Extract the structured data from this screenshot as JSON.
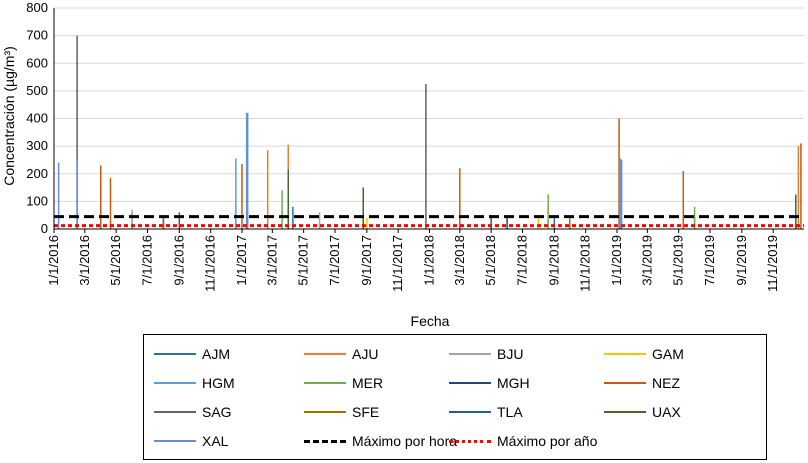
{
  "chart_data": {
    "type": "line",
    "xlabel": "Fecha",
    "ylabel": "Concentración (µg/m³)",
    "ylim": [
      0,
      800
    ],
    "yticks": [
      0,
      100,
      200,
      300,
      400,
      500,
      600,
      700,
      800
    ],
    "xlim": [
      "2016-01-01",
      "2019-12-31"
    ],
    "xtick_labels": [
      "1/1/2016",
      "3/1/2016",
      "5/1/2016",
      "7/1/2016",
      "9/1/2016",
      "11/1/2016",
      "1/1/2017",
      "3/1/2017",
      "5/1/2017",
      "7/1/2017",
      "9/1/2017",
      "11/1/2017",
      "1/1/2018",
      "3/1/2018",
      "5/1/2018",
      "7/1/2018",
      "9/1/2018",
      "11/1/2018",
      "1/1/2019",
      "3/1/2019",
      "5/1/2019",
      "7/1/2019",
      "9/1/2019",
      "11/1/2019"
    ],
    "grid": "horizontal",
    "legend_position": "bottom",
    "series": [
      {
        "name": "AJM",
        "color": "#2e6eaa",
        "style": "solid",
        "points": [
          [
            "2016-06-01",
            60
          ],
          [
            "2017-04-10",
            80
          ],
          [
            "2018-09-01",
            40
          ]
        ]
      },
      {
        "name": "AJU",
        "color": "#ed7d31",
        "style": "solid",
        "points": [
          [
            "2017-02-20",
            285
          ],
          [
            "2017-04-01",
            305
          ],
          [
            "2019-12-20",
            300
          ]
        ]
      },
      {
        "name": "BJU",
        "color": "#a5a5a5",
        "style": "solid",
        "points": [
          [
            "2016-06-01",
            70
          ],
          [
            "2017-06-01",
            60
          ],
          [
            "2019-06-01",
            60
          ]
        ]
      },
      {
        "name": "GAM",
        "color": "#ffc000",
        "style": "solid",
        "points": [
          [
            "2017-09-01",
            40
          ],
          [
            "2018-08-01",
            50
          ]
        ]
      },
      {
        "name": "HGM",
        "color": "#5b9bd5",
        "style": "solid",
        "points": [
          [
            "2016-12-20",
            255
          ],
          [
            "2017-01-10",
            420
          ],
          [
            "2019-01-10",
            250
          ]
        ]
      },
      {
        "name": "MER",
        "color": "#70ad47",
        "style": "solid",
        "points": [
          [
            "2017-03-20",
            140
          ],
          [
            "2018-08-20",
            125
          ],
          [
            "2019-06-01",
            80
          ]
        ]
      },
      {
        "name": "MGH",
        "color": "#264478",
        "style": "solid",
        "points": [
          [
            "2016-08-01",
            50
          ],
          [
            "2018-06-01",
            40
          ]
        ]
      },
      {
        "name": "NEZ",
        "color": "#c55a11",
        "style": "solid",
        "points": [
          [
            "2016-04-01",
            230
          ],
          [
            "2016-04-20",
            185
          ],
          [
            "2017-01-01",
            235
          ],
          [
            "2018-03-01",
            220
          ],
          [
            "2019-01-05",
            400
          ],
          [
            "2019-05-10",
            210
          ],
          [
            "2019-12-25",
            310
          ]
        ]
      },
      {
        "name": "SAG",
        "color": "#636363",
        "style": "solid",
        "points": [
          [
            "2016-02-15",
            700
          ],
          [
            "2017-12-25",
            525
          ]
        ]
      },
      {
        "name": "SFE",
        "color": "#997300",
        "style": "solid",
        "points": [
          [
            "2016-08-01",
            40
          ],
          [
            "2018-10-01",
            45
          ]
        ]
      },
      {
        "name": "TLA",
        "color": "#255e91",
        "style": "solid",
        "points": [
          [
            "2016-09-01",
            60
          ],
          [
            "2018-05-01",
            50
          ]
        ]
      },
      {
        "name": "UAX",
        "color": "#43682b",
        "style": "solid",
        "points": [
          [
            "2017-04-01",
            215
          ],
          [
            "2017-08-25",
            150
          ],
          [
            "2019-12-15",
            125
          ]
        ]
      },
      {
        "name": "XAL",
        "color": "#698ed0",
        "style": "solid",
        "points": [
          [
            "2016-01-10",
            240
          ],
          [
            "2016-02-15",
            250
          ],
          [
            "2017-01-12",
            420
          ],
          [
            "2019-01-08",
            255
          ]
        ]
      },
      {
        "name": "Máximo por hora",
        "color": "#000000",
        "style": "dashed",
        "points": [
          [
            "2016-01-01",
            45
          ],
          [
            "2019-12-31",
            45
          ]
        ]
      },
      {
        "name": "Máximo por año",
        "color": "#ff0000",
        "style": "dotted",
        "points": [
          [
            "2016-01-01",
            12
          ],
          [
            "2019-12-31",
            12
          ]
        ]
      }
    ]
  }
}
